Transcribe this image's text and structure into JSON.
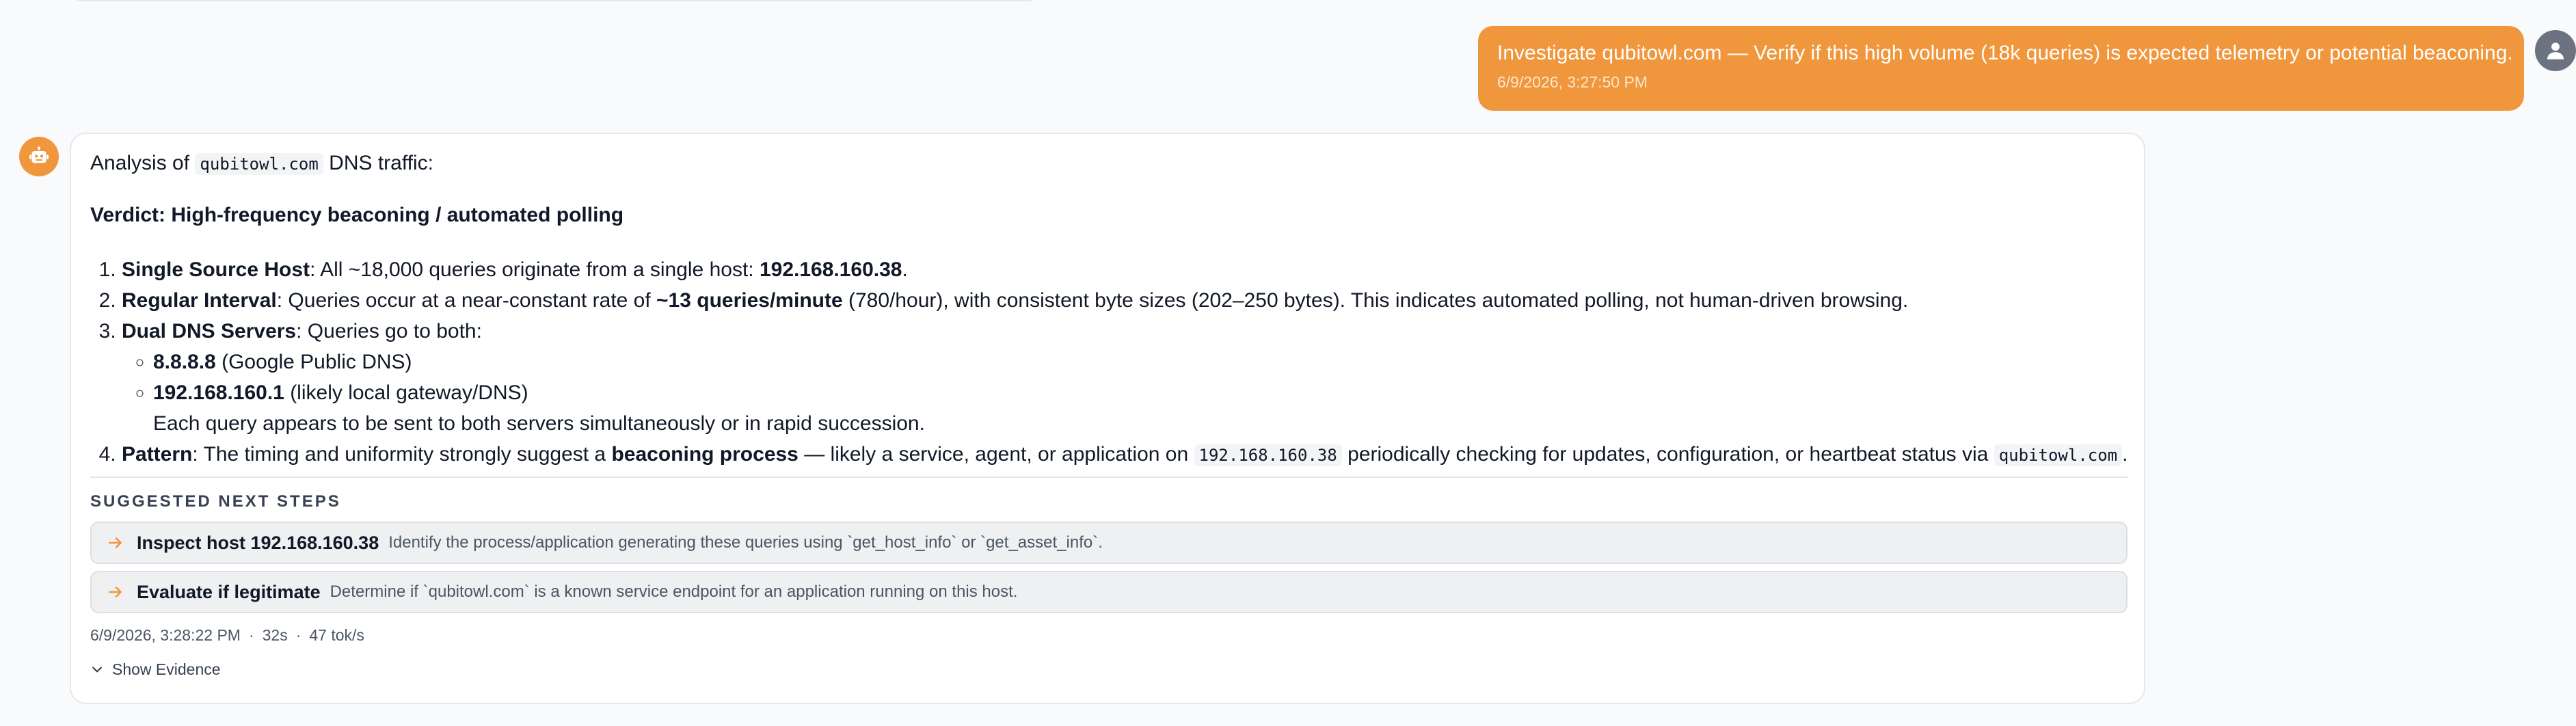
{
  "user_message": {
    "text": "Investigate qubitowl.com — Verify if this high volume (18k queries) is expected telemetry or potential beaconing.",
    "timestamp": "6/9/2026, 3:27:50 PM",
    "avatar_icon": "user-icon"
  },
  "bot_message": {
    "avatar_icon": "robot-icon",
    "intro_prefix": "Analysis of",
    "intro_code": "qubitowl.com",
    "intro_suffix": "DNS traffic:",
    "verdict": "Verdict: High-frequency beaconing / automated polling",
    "points": {
      "p1_label": "Single Source Host",
      "p1_text": ": All ~18,000 queries originate from a single host: ",
      "p1_host": "192.168.160.38",
      "p1_end": ".",
      "p2_label": "Regular Interval",
      "p2_text": ": Queries occur at a near-constant rate of ",
      "p2_rate": "~13 queries/minute",
      "p2_rest": " (780/hour), with consistent byte sizes (202–250 bytes). This indicates automated polling, not human-driven browsing.",
      "p3_label": "Dual DNS Servers",
      "p3_text": ": Queries go to both:",
      "server1_ip": "8.8.8.8",
      "server1_desc": " (Google Public DNS)",
      "server2_ip": "192.168.160.1",
      "server2_desc": " (likely local gateway/DNS)",
      "p3_note": "Each query appears to be sent to both servers simultaneously or in rapid succession.",
      "p4_label": "Pattern",
      "p4_text": ": The timing and uniformity strongly suggest a ",
      "p4_bold": "beaconing process",
      "p4_rest": " — likely a service, agent, or application on ",
      "p4_code1": "192.168.160.38",
      "p4_rest2": " periodically checking for updates, configuration, or heartbeat status via ",
      "p4_code2": "qubitowl.com",
      "p4_end": "."
    },
    "next_steps_title": "SUGGESTED NEXT STEPS",
    "next_steps": [
      {
        "title": "Inspect host 192.168.160.38",
        "desc": "Identify the process/application generating these queries using `get_host_info` or `get_asset_info`."
      },
      {
        "title": "Evaluate if legitimate",
        "desc": "Determine if `qubitowl.com` is a known service endpoint for an application running on this host."
      }
    ],
    "meta": {
      "timestamp": "6/9/2026, 3:28:22 PM",
      "duration": "32s",
      "speed": "47 tok/s",
      "separator": "·"
    },
    "show_evidence_label": "Show Evidence"
  },
  "colors": {
    "accent": "#f0963c",
    "user_avatar": "#6b7280",
    "card_border": "#e5e7eb",
    "step_bg": "#eef0f2"
  }
}
